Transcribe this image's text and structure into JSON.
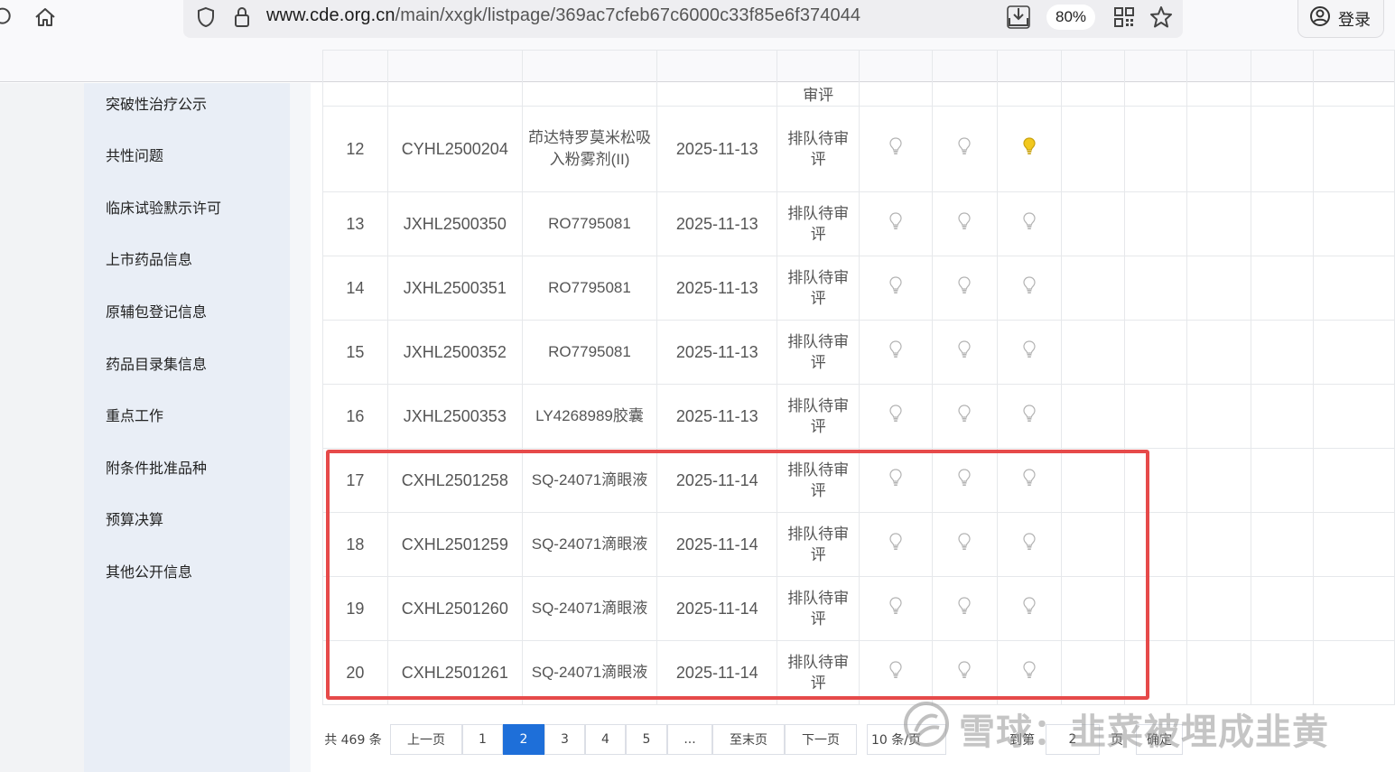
{
  "browser": {
    "url_domain": "www.cde.org.cn",
    "url_path": "/main/xxgk/listpage/369ac7cfeb67c6000c33f85e6f374044",
    "zoom": "80%",
    "login_label": "登录"
  },
  "sidebar": {
    "items": [
      {
        "label": "突破性治疗公示"
      },
      {
        "label": "共性问题"
      },
      {
        "label": "临床试验默示许可"
      },
      {
        "label": "上市药品信息"
      },
      {
        "label": "原辅包登记信息"
      },
      {
        "label": "药品目录集信息"
      },
      {
        "label": "重点工作"
      },
      {
        "label": "附条件批准品种"
      },
      {
        "label": "预算决算"
      },
      {
        "label": "其他公开信息"
      }
    ]
  },
  "table": {
    "partial_row_status": "审评",
    "rows": [
      {
        "no": "12",
        "code": "CYHL2500204",
        "name": "茚达特罗莫米松吸入粉雾剂(II)",
        "date": "2025-11-13",
        "status": "排队待审评",
        "bulbs": [
          "off",
          "off",
          "on"
        ]
      },
      {
        "no": "13",
        "code": "JXHL2500350",
        "name": "RO7795081",
        "date": "2025-11-13",
        "status": "排队待审评",
        "bulbs": [
          "off",
          "off",
          "off"
        ]
      },
      {
        "no": "14",
        "code": "JXHL2500351",
        "name": "RO7795081",
        "date": "2025-11-13",
        "status": "排队待审评",
        "bulbs": [
          "off",
          "off",
          "off"
        ]
      },
      {
        "no": "15",
        "code": "JXHL2500352",
        "name": "RO7795081",
        "date": "2025-11-13",
        "status": "排队待审评",
        "bulbs": [
          "off",
          "off",
          "off"
        ]
      },
      {
        "no": "16",
        "code": "JXHL2500353",
        "name": "LY4268989胶囊",
        "date": "2025-11-13",
        "status": "排队待审评",
        "bulbs": [
          "off",
          "off",
          "off"
        ]
      },
      {
        "no": "17",
        "code": "CXHL2501258",
        "name": "SQ-24071滴眼液",
        "date": "2025-11-14",
        "status": "排队待审评",
        "bulbs": [
          "off",
          "off",
          "off"
        ]
      },
      {
        "no": "18",
        "code": "CXHL2501259",
        "name": "SQ-24071滴眼液",
        "date": "2025-11-14",
        "status": "排队待审评",
        "bulbs": [
          "off",
          "off",
          "off"
        ]
      },
      {
        "no": "19",
        "code": "CXHL2501260",
        "name": "SQ-24071滴眼液",
        "date": "2025-11-14",
        "status": "排队待审评",
        "bulbs": [
          "off",
          "off",
          "off"
        ]
      },
      {
        "no": "20",
        "code": "CXHL2501261",
        "name": "SQ-24071滴眼液",
        "date": "2025-11-14",
        "status": "排队待审评",
        "bulbs": [
          "off",
          "off",
          "off"
        ]
      }
    ]
  },
  "pagination": {
    "total": "共 469 条",
    "prev": "上一页",
    "pages": [
      "1",
      "2",
      "3",
      "4",
      "5",
      "..."
    ],
    "current": "2",
    "last": "至末页",
    "next": "下一页",
    "page_size": "10 条/页",
    "goto": "到第",
    "goto_value": "2",
    "page_unit": "页",
    "confirm": "确定"
  },
  "watermark": {
    "text": "雪球：韭菜被埋成韭黄"
  },
  "colors": {
    "highlight": "#e64a4a",
    "active_page": "#1e6fd9",
    "bulb_on": "#f2c81e",
    "sidebar_bg": "#e9eef6"
  }
}
